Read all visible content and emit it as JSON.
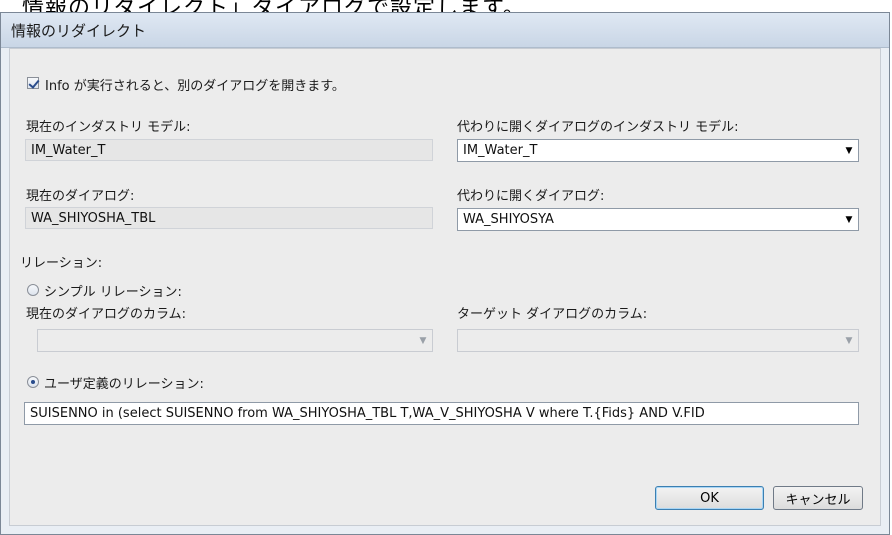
{
  "document": {
    "cropped_heading": "情報のリダイレクト」ダイアログで設定します。"
  },
  "dialog": {
    "title": "情報のリダイレクト",
    "open_other_checkbox": {
      "label": "Info が実行されると、別のダイアログを開きます。",
      "checked": true
    },
    "current_model": {
      "label": "現在のインダストリ モデル:",
      "value": "IM_Water_T"
    },
    "alt_model": {
      "label": "代わりに開くダイアログのインダストリ モデル:",
      "value": "IM_Water_T"
    },
    "current_dialog": {
      "label": "現在のダイアログ:",
      "value": "WA_SHIYOSHA_TBL"
    },
    "alt_dialog": {
      "label": "代わりに開くダイアログ:",
      "value": "WA_SHIYOSYA"
    },
    "relation": {
      "group_label": "リレーション:",
      "simple": {
        "label": "シンプル リレーション:",
        "selected": false,
        "current_column_label": "現在のダイアログのカラム:",
        "target_column_label": "ターゲット ダイアログのカラム:",
        "current_column_value": "",
        "target_column_value": ""
      },
      "custom": {
        "label": "ユーザ定義のリレーション:",
        "selected": true,
        "value": "SUISENNO in (select SUISENNO from WA_SHIYOSHA_TBL T,WA_V_SHIYOSHA V where T.{Fids} AND V.FID"
      }
    },
    "buttons": {
      "ok": "OK",
      "cancel": "キャンセル"
    }
  }
}
